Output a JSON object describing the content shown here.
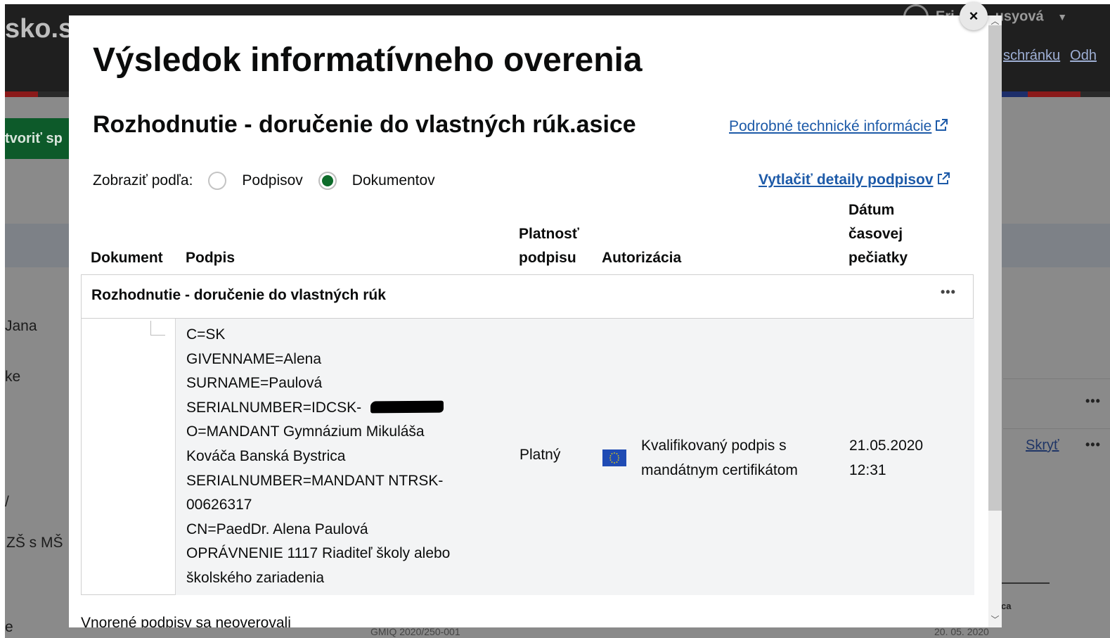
{
  "background": {
    "logo": "sko.s",
    "user_name_start": "Eri",
    "user_name_end": "usyová",
    "inbox_link": "schránku",
    "logout_link": "Odh",
    "create_button": "tvoriť sp",
    "left_items": [
      "Jana",
      "ke",
      "/",
      "ZŠ s MŠ",
      "e"
    ],
    "row_action_skryt": "Skryť",
    "dots": "•••",
    "footer_ca": "ca",
    "footer_date": "20. 05. 2020",
    "footer_code": "GMIQ 2020/250-001"
  },
  "modal": {
    "close_label": "×",
    "title": "Výsledok informatívneho overenia",
    "document_name": "Rozhodnutie - doručenie do vlastných rúk.asice",
    "tech_info_link": "Podrobné technické informácie",
    "print_link": "Vytlačiť detaily podpisov",
    "view_by_label": "Zobraziť podľa:",
    "view_options": [
      {
        "label": "Podpisov",
        "checked": false
      },
      {
        "label": "Dokumentov",
        "checked": true
      }
    ],
    "columns": {
      "dokument": "Dokument",
      "podpis": "Podpis",
      "platnost": "Platnosť podpisu",
      "autorizacia": "Autorizácia",
      "datum": "Dátum časovej pečiatky"
    },
    "group": {
      "title": "Rozhodnutie - doručenie do vlastných rúk",
      "menu": "•••"
    },
    "signature": {
      "lines": [
        "C=SK",
        "GIVENNAME=Alena",
        "SURNAME=Paulová",
        "SERIALNUMBER=IDCSK-",
        "O=MANDANT Gymnázium Mikuláša",
        "Kováča Banská Bystrica",
        "SERIALNUMBER=MANDANT NTRSK-",
        "00626317",
        "CN=PaedDr. Alena Paulová",
        "OPRÁVNENIE 1117 Riaditeľ školy alebo",
        "školského zariadenia"
      ],
      "validity": "Platný",
      "authorization_line1": "Kvalifikovaný podpis s",
      "authorization_line2": "mandátnym certifikátom",
      "date": "21.05.2020",
      "time": "12:31"
    },
    "nested_note": "Vnorené podpisy sa neoverovali"
  }
}
